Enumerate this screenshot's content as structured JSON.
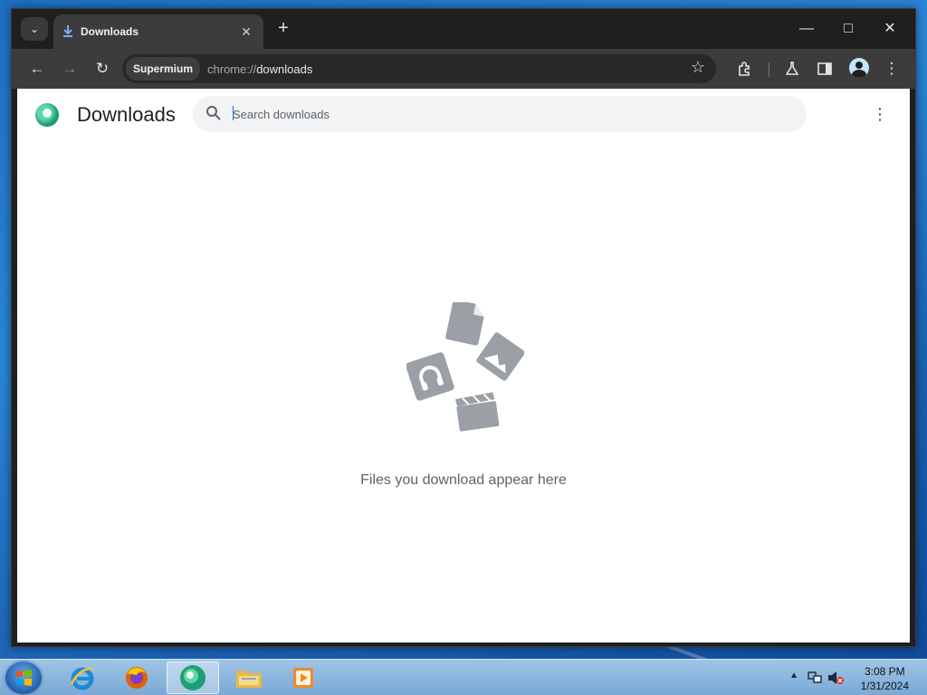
{
  "browser": {
    "tab": {
      "title": "Downloads"
    },
    "omnibox": {
      "chip": "Supermium",
      "url_scheme": "chrome://",
      "url_host": "downloads"
    }
  },
  "downloads_page": {
    "title": "Downloads",
    "search_placeholder": "Search downloads",
    "empty_message": "Files you download appear here"
  },
  "taskbar": {
    "clock_time": "3:08 PM",
    "clock_date": "1/31/2024"
  },
  "colors": {
    "tab_icon": "#7cacf8",
    "illustration": "#9aa0a6",
    "page_bg": "#ffffff",
    "browser_frame": "#1f1f1f"
  },
  "icons": [
    "tab-search-icon",
    "download-icon",
    "close-icon",
    "plus-icon",
    "minimize-icon",
    "maximize-icon",
    "back-icon",
    "forward-icon",
    "reload-icon",
    "star-icon",
    "extensions-icon",
    "labs-icon",
    "side-panel-icon",
    "profile-icon",
    "menu-icon",
    "search-icon",
    "windows-start-icon",
    "internet-explorer-icon",
    "firefox-icon",
    "supermium-icon",
    "folder-icon",
    "media-player-icon",
    "network-icon",
    "volume-muted-icon"
  ]
}
